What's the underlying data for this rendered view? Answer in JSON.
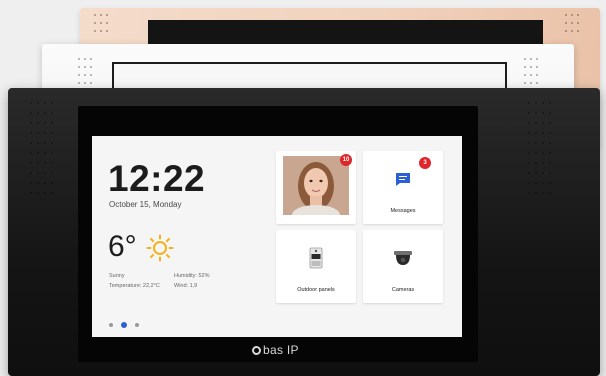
{
  "home": {
    "time": "12:22",
    "date": "October 15, Monday",
    "temperature": "6°",
    "weather": {
      "condition": "Sunny",
      "temperature_line": "Temperature: 22,2°C",
      "humidity_line": "Humidity: 52%",
      "wind_line": "Wind: 1,9"
    },
    "pager": {
      "count": 3,
      "active_index": 1
    }
  },
  "tiles": {
    "intercom": {
      "badge": "10"
    },
    "messages": {
      "label": "Messages",
      "badge": "3"
    },
    "outdoor": {
      "label": "Outdoor panels"
    },
    "cameras": {
      "label": "Cameras"
    }
  },
  "brand": {
    "logo_text": "bas IP"
  },
  "colors": {
    "accent": "#2c5fd4",
    "badge": "#e0262b"
  }
}
